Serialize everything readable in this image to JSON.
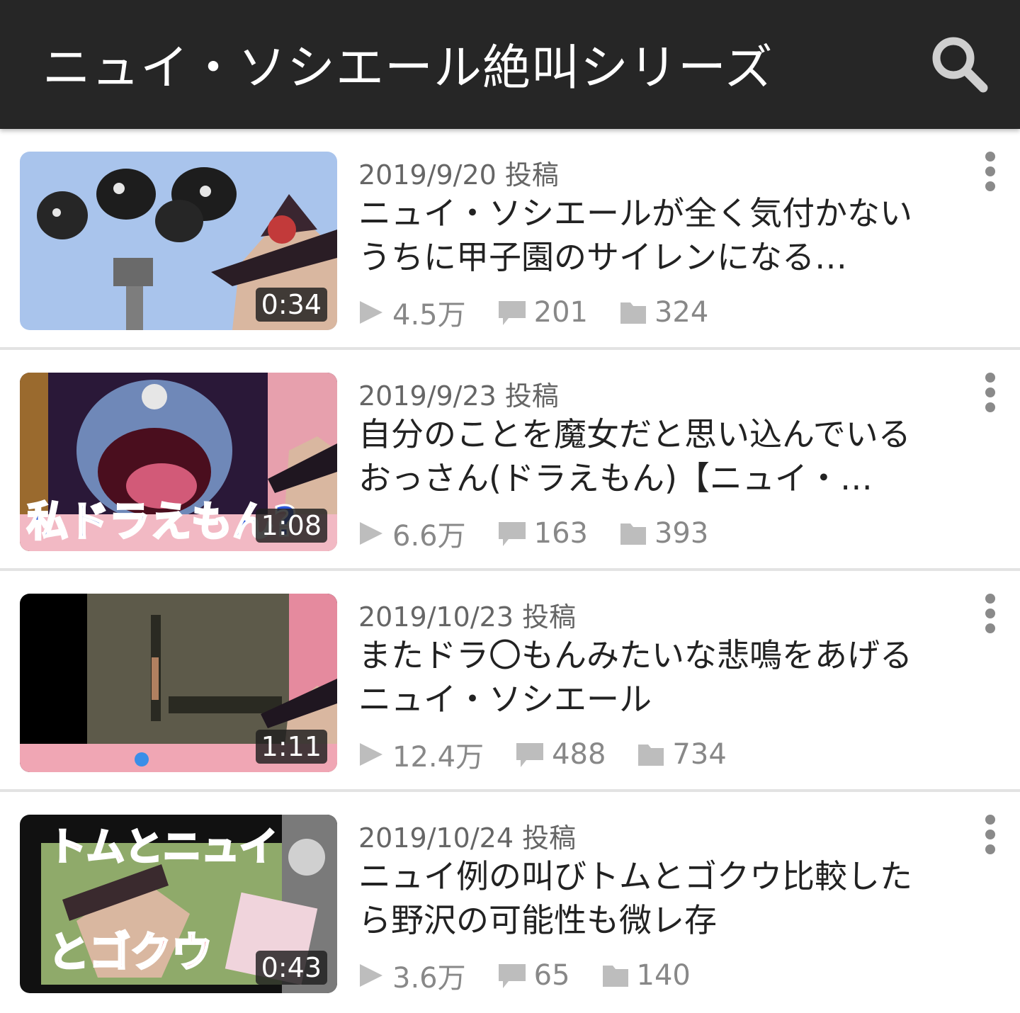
{
  "header": {
    "title": "ニュイ・ソシエール絶叫シリーズ",
    "search_icon": "search-icon"
  },
  "videos": [
    {
      "date": "2019/9/20 投稿",
      "title": "ニュイ・ソシエールが全く気付かないうちに甲子園のサイレンになる…",
      "duration": "0:34",
      "views": "4.5万",
      "comments": "201",
      "mylists": "324"
    },
    {
      "date": "2019/9/23 投稿",
      "title": "自分のことを魔女だと思い込んでいるおっさん(ドラえもん)【ニュイ・…",
      "duration": "1:08",
      "views": "6.6万",
      "comments": "163",
      "mylists": "393",
      "thumb_text": "私ドラえもん?"
    },
    {
      "date": "2019/10/23 投稿",
      "title": "またドラ〇もんみたいな悲鳴をあげるニュイ・ソシエール",
      "duration": "1:11",
      "views": "12.4万",
      "comments": "488",
      "mylists": "734"
    },
    {
      "date": "2019/10/24 投稿",
      "title": "ニュイ例の叫びトムとゴクウ比較したら野沢の可能性も微レ存",
      "duration": "0:43",
      "views": "3.6万",
      "comments": "65",
      "mylists": "140",
      "thumb_text_top": "トムとニュイ",
      "thumb_text_bottom": "とゴクウ"
    }
  ],
  "colors": {
    "header_bg": "#262626",
    "meta_gray": "#888888",
    "divider": "#e3e3e3"
  }
}
